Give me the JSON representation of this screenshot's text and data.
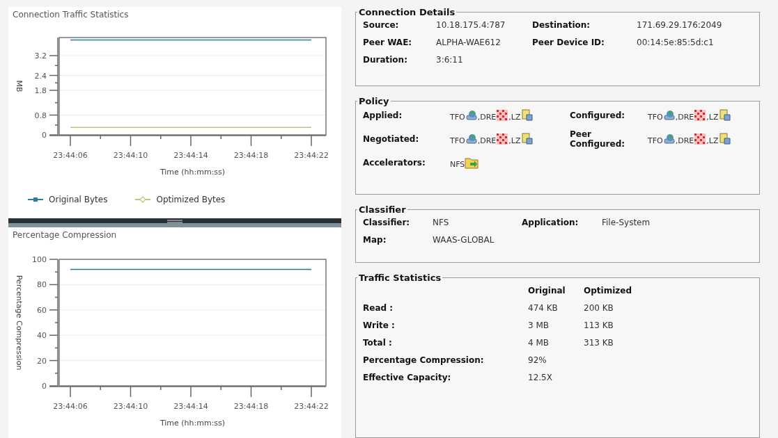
{
  "charts": [
    {
      "title": "Connection Traffic Statistics",
      "chart_data": {
        "type": "line",
        "ylabel": "MB",
        "xlabel": "Time (hh:mm:ss)",
        "categories": [
          "23:44:06",
          "23:44:10",
          "23:44:14",
          "23:44:18",
          "23:44:22"
        ],
        "ylim": [
          0,
          3.93
        ],
        "yticks": [
          0,
          0.8,
          1.8,
          2.4,
          3.2
        ],
        "grid": true,
        "series": [
          {
            "name": "Original Bytes",
            "color": "#2e7f92",
            "values": [
              3.83,
              3.83,
              3.83,
              3.83,
              3.83
            ]
          },
          {
            "name": "Optimized Bytes",
            "color": "#b5c97a",
            "values": [
              0.3,
              0.3,
              0.3,
              0.3,
              0.3
            ]
          }
        ]
      }
    },
    {
      "title": "Percentage Compression",
      "chart_data": {
        "type": "line",
        "ylabel": "Percentage Compression",
        "xlabel": "Time (hh:mm:ss)",
        "categories": [
          "23:44:06",
          "23:44:10",
          "23:44:14",
          "23:44:18",
          "23:44:22"
        ],
        "ylim": [
          0,
          100
        ],
        "yticks": [
          0,
          20,
          40,
          60,
          80,
          100
        ],
        "grid": true,
        "series": [
          {
            "color": "#1f7a90",
            "values": [
              92,
              92,
              92,
              92,
              92
            ]
          }
        ]
      }
    }
  ],
  "connection_details": {
    "title": "Connection Details",
    "rows": [
      [
        {
          "label": "Source:",
          "value": "10.18.175.4:787"
        },
        {
          "label": "Destination:",
          "value": "171.69.29.176:2049"
        }
      ],
      [
        {
          "label": "Peer WAE:",
          "value": "ALPHA-WAE612"
        },
        {
          "label": "Peer Device ID:",
          "value": "00:14:5e:85:5d:c1"
        }
      ],
      [
        {
          "label": "Duration:",
          "value": "3:6:11"
        }
      ]
    ]
  },
  "policy": {
    "title": "Policy",
    "rows": [
      [
        {
          "label": "Applied:",
          "items": [
            {
              "text": "TFO",
              "kind": "tfo"
            },
            {
              "text": ",DRE",
              "kind": "dre"
            },
            {
              "text": ",LZ",
              "kind": "lz"
            }
          ]
        },
        {
          "label": "Configured:",
          "items": [
            {
              "text": "TFO",
              "kind": "tfo"
            },
            {
              "text": ",DRE",
              "kind": "dre"
            },
            {
              "text": ",LZ",
              "kind": "lz"
            }
          ]
        }
      ],
      [
        {
          "label": "Negotiated:",
          "items": [
            {
              "text": "TFO",
              "kind": "tfo"
            },
            {
              "text": ",DRE",
              "kind": "dre"
            },
            {
              "text": ",LZ",
              "kind": "lz"
            }
          ]
        },
        {
          "label": "Peer Configured:",
          "items": [
            {
              "text": "TFO",
              "kind": "tfo"
            },
            {
              "text": ",DRE",
              "kind": "dre"
            },
            {
              "text": ",LZ",
              "kind": "lz"
            }
          ]
        }
      ],
      [
        {
          "label": "Accelerators:",
          "items": [
            {
              "text": "NFS",
              "kind": "nfs"
            }
          ]
        }
      ]
    ]
  },
  "classifier": {
    "title": "Classifier",
    "rows": [
      [
        {
          "label": "Classifier:",
          "value": "NFS"
        },
        {
          "label": "Application:",
          "value": "File-System"
        }
      ],
      [
        {
          "label": "Map:",
          "value": "WAAS-GLOBAL"
        }
      ]
    ]
  },
  "traffic_statistics": {
    "title": "Traffic Statistics",
    "columns": [
      "Original",
      "Optimized"
    ],
    "rows": [
      {
        "label": "Read :",
        "values": [
          "474 KB",
          "200 KB"
        ]
      },
      {
        "label": "Write :",
        "values": [
          "3 MB",
          "113 KB"
        ]
      },
      {
        "label": "Total :",
        "values": [
          "4 MB",
          "313 KB"
        ]
      },
      {
        "label": "Percentage Compression:",
        "values": [
          "92%"
        ]
      },
      {
        "label": "Effective Capacity:",
        "values": [
          "12.5X"
        ]
      }
    ]
  }
}
